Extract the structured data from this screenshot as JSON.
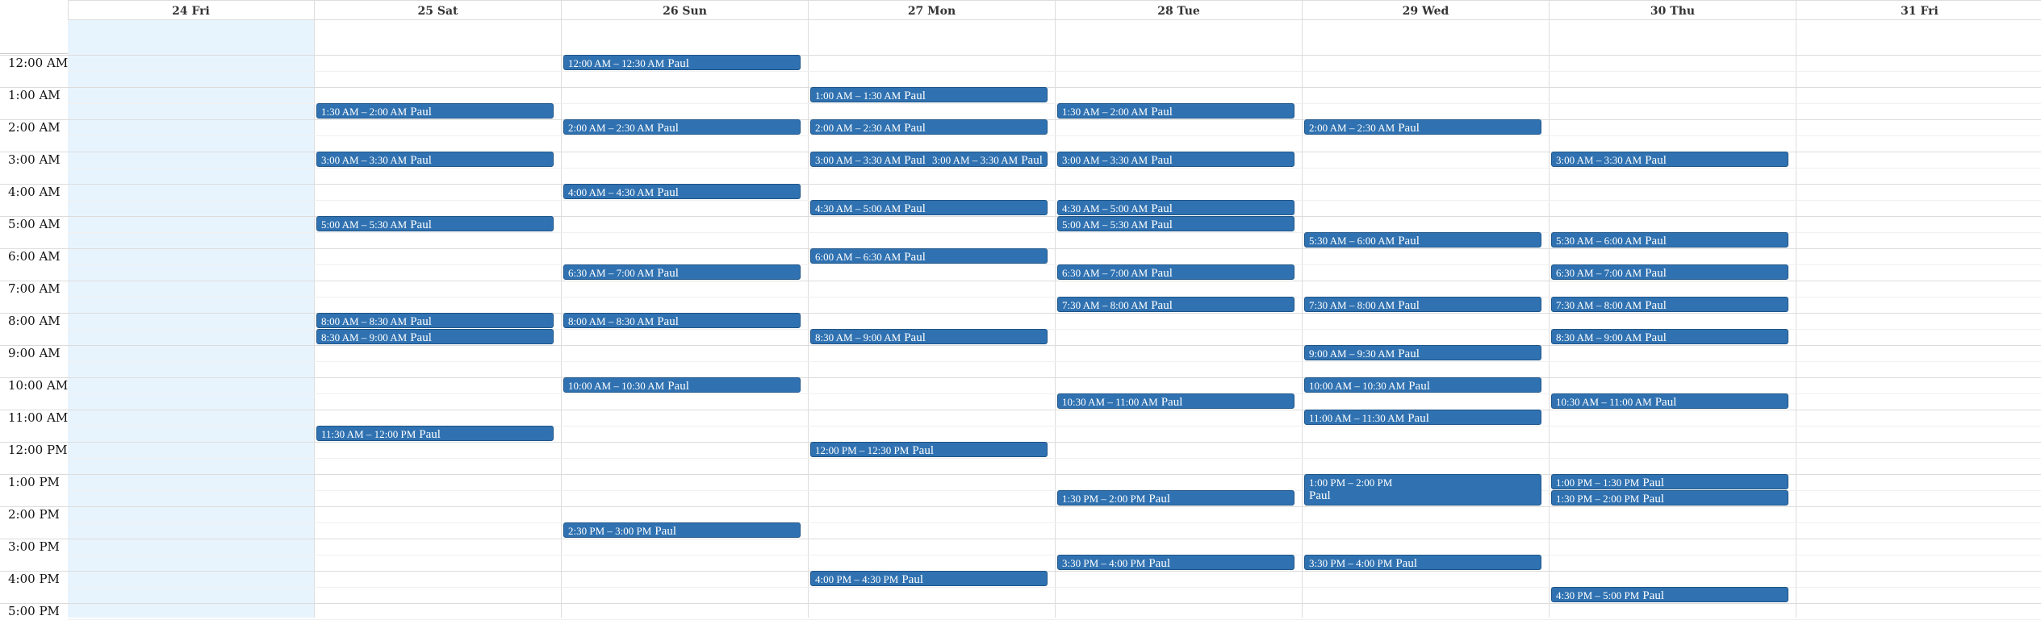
{
  "days": [
    {
      "label": "24 Fri",
      "today": true
    },
    {
      "label": "25 Sat"
    },
    {
      "label": "26 Sun"
    },
    {
      "label": "27 Mon"
    },
    {
      "label": "28 Tue"
    },
    {
      "label": "29 Wed"
    },
    {
      "label": "30 Thu"
    },
    {
      "label": "31 Fri"
    }
  ],
  "hours": [
    "12:00 AM",
    "1:00 AM",
    "2:00 AM",
    "3:00 AM",
    "4:00 AM",
    "5:00 AM",
    "6:00 AM",
    "7:00 AM",
    "8:00 AM",
    "9:00 AM",
    "10:00 AM",
    "11:00 AM",
    "12:00 PM",
    "1:00 PM",
    "2:00 PM",
    "3:00 PM",
    "4:00 PM",
    "5:00 PM"
  ],
  "events": [
    {
      "day": 1,
      "start": 1.5,
      "time": "1:30 AM – 2:00 AM",
      "who": "Paul"
    },
    {
      "day": 1,
      "start": 3,
      "time": "3:00 AM – 3:30 AM",
      "who": "Paul"
    },
    {
      "day": 1,
      "start": 5,
      "time": "5:00 AM – 5:30 AM",
      "who": "Paul"
    },
    {
      "day": 1,
      "start": 8,
      "time": "8:00 AM – 8:30 AM",
      "who": "Paul"
    },
    {
      "day": 1,
      "start": 8.5,
      "time": "8:30 AM – 9:00 AM",
      "who": "Paul"
    },
    {
      "day": 1,
      "start": 11.5,
      "time": "11:30 AM – 12:00 PM",
      "who": "Paul"
    },
    {
      "day": 2,
      "start": 0,
      "time": "12:00 AM – 12:30 AM",
      "who": "Paul"
    },
    {
      "day": 2,
      "start": 2,
      "time": "2:00 AM – 2:30 AM",
      "who": "Paul"
    },
    {
      "day": 2,
      "start": 4,
      "time": "4:00 AM – 4:30 AM",
      "who": "Paul"
    },
    {
      "day": 2,
      "start": 6.5,
      "time": "6:30 AM – 7:00 AM",
      "who": "Paul"
    },
    {
      "day": 2,
      "start": 8,
      "time": "8:00 AM – 8:30 AM",
      "who": "Paul"
    },
    {
      "day": 2,
      "start": 10,
      "time": "10:00 AM – 10:30 AM",
      "who": "Paul"
    },
    {
      "day": 2,
      "start": 14.5,
      "time": "2:30 PM – 3:00 PM",
      "who": "Paul"
    },
    {
      "day": 3,
      "start": 1,
      "time": "1:00 AM – 1:30 AM",
      "who": "Paul"
    },
    {
      "day": 3,
      "start": 2,
      "time": "2:00 AM – 2:30 AM",
      "who": "Paul"
    },
    {
      "day": 3,
      "start": 3,
      "time": "3:00 AM – 3:30 AM",
      "who": "Paul",
      "time2": "3:00 AM – 3:30 AM",
      "who2": "Paul"
    },
    {
      "day": 3,
      "start": 4.5,
      "time": "4:30 AM – 5:00 AM",
      "who": "Paul"
    },
    {
      "day": 3,
      "start": 6,
      "time": "6:00 AM – 6:30 AM",
      "who": "Paul"
    },
    {
      "day": 3,
      "start": 8.5,
      "time": "8:30 AM – 9:00 AM",
      "who": "Paul"
    },
    {
      "day": 3,
      "start": 12,
      "time": "12:00 PM – 12:30 PM",
      "who": "Paul"
    },
    {
      "day": 3,
      "start": 16,
      "time": "4:00 PM – 4:30 PM",
      "who": "Paul"
    },
    {
      "day": 4,
      "start": 1.5,
      "time": "1:30 AM – 2:00 AM",
      "who": "Paul"
    },
    {
      "day": 4,
      "start": 3,
      "time": "3:00 AM – 3:30 AM",
      "who": "Paul"
    },
    {
      "day": 4,
      "start": 4.5,
      "time": "4:30 AM – 5:00 AM",
      "who": "Paul"
    },
    {
      "day": 4,
      "start": 5,
      "time": "5:00 AM – 5:30 AM",
      "who": "Paul"
    },
    {
      "day": 4,
      "start": 6.5,
      "time": "6:30 AM – 7:00 AM",
      "who": "Paul"
    },
    {
      "day": 4,
      "start": 7.5,
      "time": "7:30 AM – 8:00 AM",
      "who": "Paul"
    },
    {
      "day": 4,
      "start": 10.5,
      "time": "10:30 AM – 11:00 AM",
      "who": "Paul"
    },
    {
      "day": 4,
      "start": 13.5,
      "time": "1:30 PM – 2:00 PM",
      "who": "Paul"
    },
    {
      "day": 4,
      "start": 15.5,
      "time": "3:30 PM – 4:00 PM",
      "who": "Paul"
    },
    {
      "day": 5,
      "start": 2,
      "time": "2:00 AM – 2:30 AM",
      "who": "Paul"
    },
    {
      "day": 5,
      "start": 5.5,
      "time": "5:30 AM – 6:00 AM",
      "who": "Paul"
    },
    {
      "day": 5,
      "start": 7.5,
      "time": "7:30 AM – 8:00 AM",
      "who": "Paul"
    },
    {
      "day": 5,
      "start": 9,
      "time": "9:00 AM – 9:30 AM",
      "who": "Paul"
    },
    {
      "day": 5,
      "start": 10,
      "time": "10:00 AM – 10:30 AM",
      "who": "Paul"
    },
    {
      "day": 5,
      "start": 11,
      "time": "11:00 AM – 11:30 AM",
      "who": "Paul"
    },
    {
      "day": 5,
      "start": 13,
      "duration": 1,
      "time": "1:00 PM – 2:00 PM",
      "who": "Paul"
    },
    {
      "day": 5,
      "start": 15.5,
      "time": "3:30 PM – 4:00 PM",
      "who": "Paul"
    },
    {
      "day": 6,
      "start": 3,
      "time": "3:00 AM – 3:30 AM",
      "who": "Paul"
    },
    {
      "day": 6,
      "start": 5.5,
      "time": "5:30 AM – 6:00 AM",
      "who": "Paul"
    },
    {
      "day": 6,
      "start": 6.5,
      "time": "6:30 AM – 7:00 AM",
      "who": "Paul"
    },
    {
      "day": 6,
      "start": 7.5,
      "time": "7:30 AM – 8:00 AM",
      "who": "Paul"
    },
    {
      "day": 6,
      "start": 8.5,
      "time": "8:30 AM – 9:00 AM",
      "who": "Paul"
    },
    {
      "day": 6,
      "start": 10.5,
      "time": "10:30 AM – 11:00 AM",
      "who": "Paul"
    },
    {
      "day": 6,
      "start": 13,
      "time": "1:00 PM – 1:30 PM",
      "who": "Paul"
    },
    {
      "day": 6,
      "start": 13.5,
      "time": "1:30 PM – 2:00 PM",
      "who": "Paul"
    },
    {
      "day": 6,
      "start": 16.5,
      "time": "4:30 PM – 5:00 PM",
      "who": "Paul"
    }
  ]
}
